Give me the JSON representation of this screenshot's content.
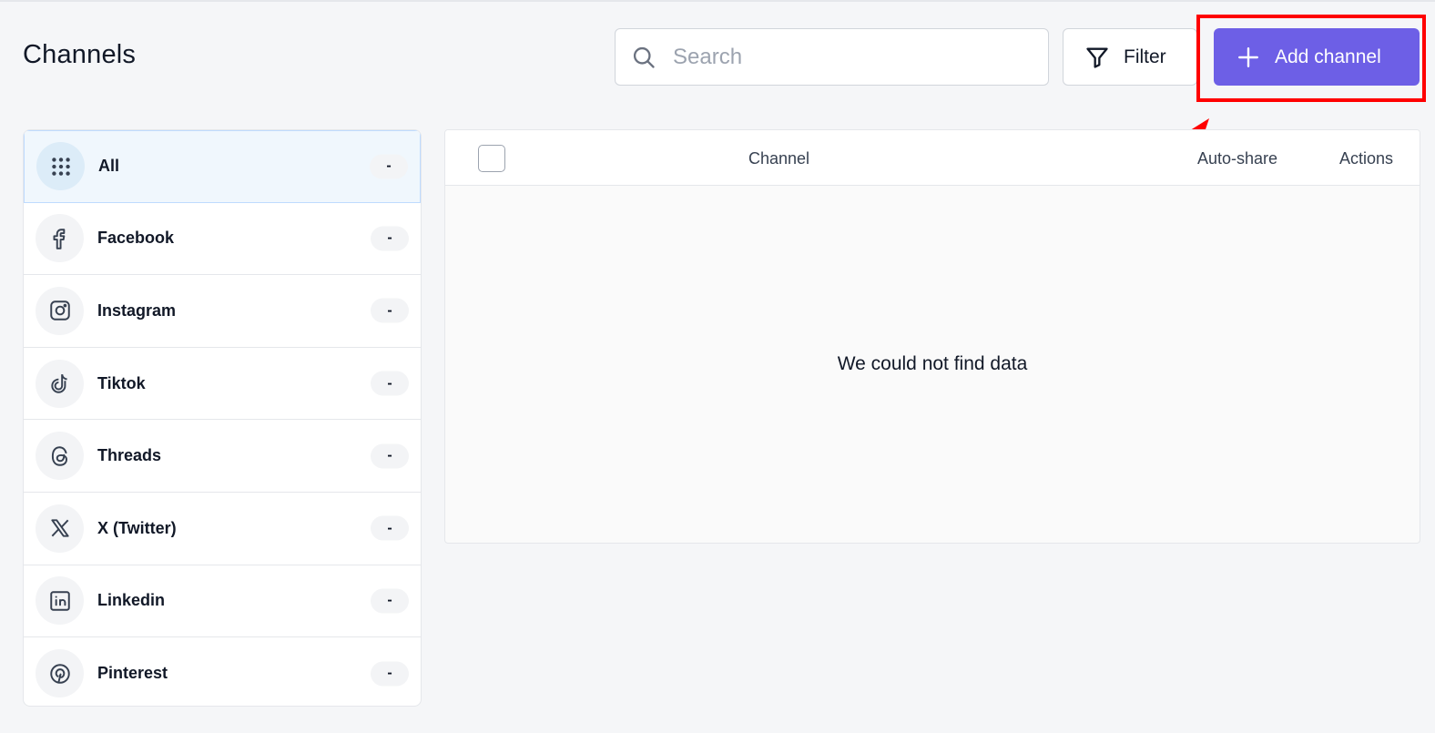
{
  "page": {
    "title": "Channels"
  },
  "toolbar": {
    "search_placeholder": "Search",
    "filter_label": "Filter",
    "add_label": "Add channel",
    "accent_color": "#6d5fe6",
    "highlight_color": "#ff0000"
  },
  "sidebar": {
    "items": [
      {
        "label": "All",
        "count": "-",
        "icon": "grid-dots-icon",
        "active": true
      },
      {
        "label": "Facebook",
        "count": "-",
        "icon": "facebook-icon"
      },
      {
        "label": "Instagram",
        "count": "-",
        "icon": "instagram-icon"
      },
      {
        "label": "Tiktok",
        "count": "-",
        "icon": "tiktok-icon"
      },
      {
        "label": "Threads",
        "count": "-",
        "icon": "threads-icon"
      },
      {
        "label": "X (Twitter)",
        "count": "-",
        "icon": "x-twitter-icon"
      },
      {
        "label": "Linkedin",
        "count": "-",
        "icon": "linkedin-icon"
      },
      {
        "label": "Pinterest",
        "count": "-",
        "icon": "pinterest-icon"
      }
    ]
  },
  "table": {
    "columns": [
      "Channel",
      "Auto-share",
      "Actions"
    ],
    "empty_message": "We could not find data"
  }
}
